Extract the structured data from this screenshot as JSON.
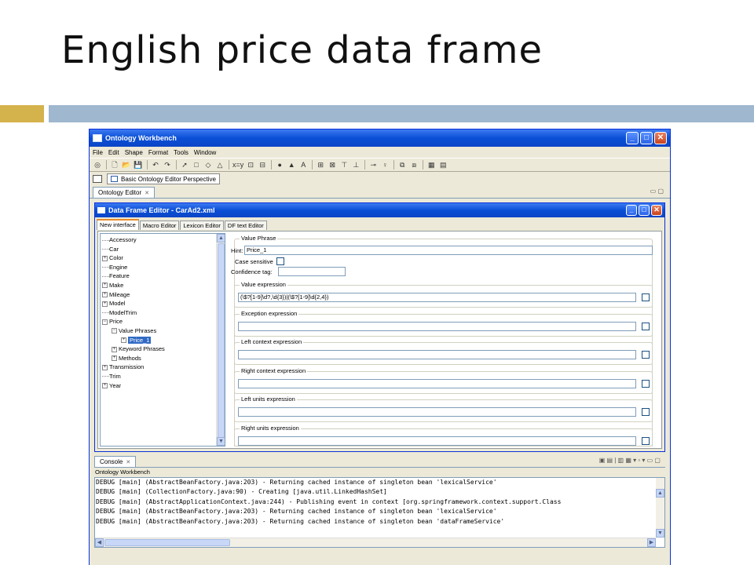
{
  "slide": {
    "title": "English price data frame"
  },
  "window": {
    "title": "Ontology Workbench",
    "minimize": "_",
    "maximize": "□",
    "close": "✕"
  },
  "menu": [
    "File",
    "Edit",
    "Shape",
    "Format",
    "Tools",
    "Window"
  ],
  "toolbar": {
    "icons": [
      "target-icon",
      "new-file-icon",
      "open-folder-icon",
      "save-icon",
      "undo-icon",
      "redo-icon",
      "pointer-icon",
      "rectangle-icon",
      "diamond-icon",
      "triangle-icon",
      "xy-icon",
      "box-a-icon",
      "box-b-icon",
      "dot-icon",
      "filled-triangle-icon",
      "text-a-icon",
      "align-icon",
      "distribute-icon",
      "align-top-icon",
      "align-bottom-icon",
      "link-icon",
      "person-icon",
      "group-icon",
      "ungroup-icon",
      "grid-icon",
      "panel-icon"
    ],
    "glyphs": [
      "◎",
      "🗋",
      "📂",
      "💾",
      "↶",
      "↷",
      "➚",
      "□",
      "◇",
      "△",
      "x=y",
      "⊡",
      "⊟",
      "●",
      "▲",
      "A",
      "⊞",
      "⊠",
      "⊤",
      "⊥",
      "⊸",
      "♀",
      "⧉",
      "⧈",
      "▦",
      "▤"
    ]
  },
  "perspective": {
    "label": "Basic Ontology Editor Perspective"
  },
  "editor_tab": {
    "label": "Ontology Editor",
    "close": "✕",
    "pane_controls": "▭ ▢"
  },
  "dfe": {
    "title": "Data Frame Editor - CarAd2.xml",
    "tabs": [
      "New interface",
      "Macro Editor",
      "Lexicon Editor",
      "DF text Editor"
    ],
    "tree": [
      {
        "label": "Accessory",
        "level": 0,
        "exp": ""
      },
      {
        "label": "Car",
        "level": 0,
        "exp": ""
      },
      {
        "label": "Color",
        "level": 0,
        "exp": "+"
      },
      {
        "label": "Engine",
        "level": 0,
        "exp": ""
      },
      {
        "label": "Feature",
        "level": 0,
        "exp": ""
      },
      {
        "label": "Make",
        "level": 0,
        "exp": "+"
      },
      {
        "label": "Mileage",
        "level": 0,
        "exp": "+"
      },
      {
        "label": "Model",
        "level": 0,
        "exp": "+"
      },
      {
        "label": "ModelTrim",
        "level": 0,
        "exp": ""
      },
      {
        "label": "Price",
        "level": 0,
        "exp": "−"
      },
      {
        "label": "Value Phrases",
        "level": 1,
        "exp": "−"
      },
      {
        "label": "Price_1",
        "level": 2,
        "exp": "+",
        "selected": true
      },
      {
        "label": "Keyword Phrases",
        "level": 1,
        "exp": "+"
      },
      {
        "label": "Methods",
        "level": 1,
        "exp": "+"
      },
      {
        "label": "Transmission",
        "level": 0,
        "exp": "+"
      },
      {
        "label": "Trim",
        "level": 0,
        "exp": ""
      },
      {
        "label": "Year",
        "level": 0,
        "exp": "+"
      }
    ],
    "value_phrase": {
      "group_label": "Value Phrase",
      "hint_label": "Hint:",
      "hint_value": "Price_1",
      "case_label": "Case sensitive",
      "confidence_label": "Confidence tag:",
      "confidence_value": ""
    },
    "expressions": [
      {
        "label": "Value expression",
        "value": "(\\$?[1-9]\\d?,\\d{3})|(\\$?[1-9]\\d{2,4})"
      },
      {
        "label": "Exception expression",
        "value": ""
      },
      {
        "label": "Left context expression",
        "value": ""
      },
      {
        "label": "Right context expression",
        "value": ""
      },
      {
        "label": "Left units expression",
        "value": ""
      },
      {
        "label": "Right units expression",
        "value": ""
      }
    ]
  },
  "console": {
    "tab_label": "Console",
    "close": "✕",
    "subtitle": "Ontology Workbench",
    "tool_glyphs": "▣ ▤ | ▥ ▦ ▾ ▫ ▾ ▭ ▢",
    "lines": [
      "DEBUG [main] (AbstractBeanFactory.java:203) - Returning cached instance of singleton bean 'lexicalService'",
      "DEBUG [main] (CollectionFactory.java:90) - Creating [java.util.LinkedHashSet]",
      "DEBUG [main] (AbstractApplicationContext.java:244) - Publishing event in context [org.springframework.context.support.Class",
      "DEBUG [main] (AbstractBeanFactory.java:203) - Returning cached instance of singleton bean 'lexicalService'",
      "DEBUG [main] (AbstractBeanFactory.java:203) - Returning cached instance of singleton bean 'dataFrameService'"
    ]
  },
  "colors": {
    "titlebar": "#0a4fd6",
    "gold_bar": "#d4b24c",
    "blue_bar": "#9fb7cf",
    "selection": "#316ac5"
  }
}
